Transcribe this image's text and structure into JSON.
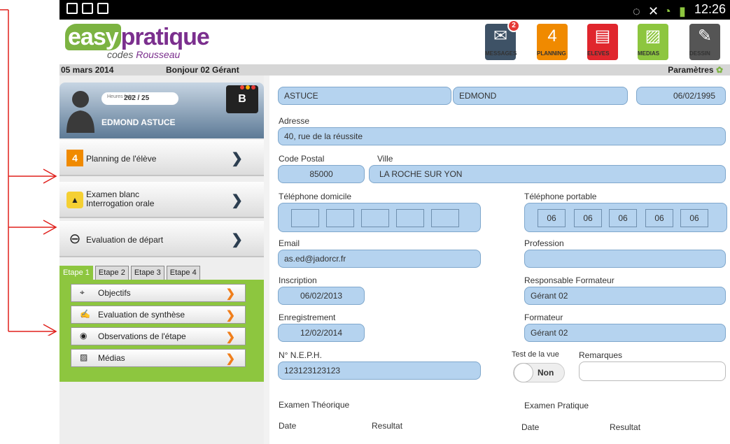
{
  "status_bar": {
    "time": "12:26",
    "left_icons": [
      "gallery-icon",
      "checkbox-icon",
      "download-icon"
    ],
    "right_icons": [
      "eye-icon",
      "mute-icon",
      "wifi-icon",
      "battery-icon"
    ]
  },
  "logo": {
    "word1": "easy",
    "word2": "pratique",
    "sub1": "codes",
    "sub2": "Rousseau"
  },
  "top_buttons": [
    {
      "label": "MESSAGES",
      "badge": "2",
      "color": "#3e5266",
      "icon": "envelope-icon"
    },
    {
      "label": "PLANNING",
      "color": "#f08a00",
      "icon": "calendar-icon",
      "icon_text": "4"
    },
    {
      "label": "ELEVES",
      "color": "#e0262d",
      "icon": "students-icon"
    },
    {
      "label": "MEDIAS",
      "color": "#8dc63f",
      "icon": "image-icon"
    },
    {
      "label": "DESSIN",
      "color": "#555555",
      "icon": "pencil-icon"
    }
  ],
  "date_bar": {
    "date": "05 mars 2014",
    "greeting": "Bonjour 02 Gérant",
    "settings": "Paramètres"
  },
  "profile": {
    "hours_label": "Heures faites",
    "hours_value": "262 / 25",
    "name": "EDMOND ASTUCE",
    "letter": "B"
  },
  "nav": [
    {
      "label": "Planning de l'élève",
      "icon": "calendar-icon"
    },
    {
      "label_1": "Examen blanc",
      "label_2": "Interrogation orale",
      "icon": "graduation-cap-icon"
    },
    {
      "label": "Evaluation de départ",
      "icon": "steering-person-icon"
    }
  ],
  "tabs": [
    "Etape 1",
    "Etape 2",
    "Etape 3",
    "Etape 4"
  ],
  "step_items": [
    {
      "label": "Objectifs",
      "icon": "target-icon"
    },
    {
      "label": "Evaluation de synthèse",
      "icon": "notepad-icon"
    },
    {
      "label": "Observations de l'étape",
      "icon": "eye-icon"
    },
    {
      "label": "Médias",
      "icon": "image-icon"
    }
  ],
  "form": {
    "last_name": "ASTUCE",
    "first_name": "EDMOND",
    "birth_date": "06/02/1995",
    "address_label": "Adresse",
    "address": "40, rue de la réussite",
    "postal_label": "Code Postal",
    "postal": "85000",
    "city_label": "Ville",
    "city": "LA ROCHE SUR YON",
    "home_phone_label": "Téléphone domicile",
    "home_phone": [
      "",
      "",
      "",
      "",
      ""
    ],
    "mobile_label": "Téléphone portable",
    "mobile": [
      "06",
      "06",
      "06",
      "06",
      "06"
    ],
    "email_label": "Email",
    "email": "as.ed@jadorcr.fr",
    "profession_label": "Profession",
    "profession": "",
    "inscription_label": "Inscription",
    "inscription": "06/02/2013",
    "resp_label": "Responsable Formateur",
    "resp": "Gérant 02",
    "enregistrement_label": "Enregistrement",
    "enregistrement": "12/02/2014",
    "formateur_label": "Formateur",
    "formateur": "Gérant 02",
    "neph_label": "N° N.E.P.H.",
    "neph": "123123123123",
    "vision_label": "Test de la vue",
    "vision_value": "Non",
    "remarks_label": "Remarques",
    "exam_theo": "Examen Théorique",
    "exam_prat": "Examen Pratique",
    "date_label": "Date",
    "result_label": "Resultat"
  }
}
